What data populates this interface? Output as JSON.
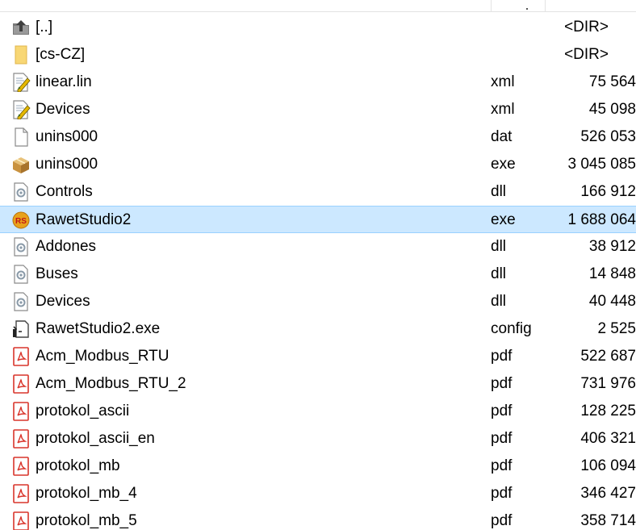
{
  "files": [
    {
      "name": "[..]",
      "ext": "",
      "size": "<DIR>",
      "icon": "up-folder-icon",
      "selected": false,
      "is_dir": true
    },
    {
      "name": "[cs-CZ]",
      "ext": "",
      "size": "<DIR>",
      "icon": "folder-icon",
      "selected": false,
      "is_dir": true
    },
    {
      "name": "linear.lin",
      "ext": "xml",
      "size": "75 564",
      "icon": "xml-file-icon",
      "selected": false,
      "is_dir": false
    },
    {
      "name": "Devices",
      "ext": "xml",
      "size": "45 098",
      "icon": "xml-file-icon",
      "selected": false,
      "is_dir": false
    },
    {
      "name": "unins000",
      "ext": "dat",
      "size": "526 053",
      "icon": "blank-file-icon",
      "selected": false,
      "is_dir": false
    },
    {
      "name": "unins000",
      "ext": "exe",
      "size": "3 045 085",
      "icon": "installer-box-icon",
      "selected": false,
      "is_dir": false
    },
    {
      "name": "Controls",
      "ext": "dll",
      "size": "166 912",
      "icon": "dll-file-icon",
      "selected": false,
      "is_dir": false
    },
    {
      "name": "RawetStudio2",
      "ext": "exe",
      "size": "1 688 064",
      "icon": "rawet-studio-icon",
      "selected": true,
      "is_dir": false
    },
    {
      "name": "Addones",
      "ext": "dll",
      "size": "38 912",
      "icon": "dll-file-icon",
      "selected": false,
      "is_dir": false
    },
    {
      "name": "Buses",
      "ext": "dll",
      "size": "14 848",
      "icon": "dll-file-icon",
      "selected": false,
      "is_dir": false
    },
    {
      "name": "Devices",
      "ext": "dll",
      "size": "40 448",
      "icon": "dll-file-icon",
      "selected": false,
      "is_dir": false
    },
    {
      "name": "RawetStudio2.exe",
      "ext": "config",
      "size": "2 525",
      "icon": "config-file-icon",
      "selected": false,
      "is_dir": false
    },
    {
      "name": "Acm_Modbus_RTU",
      "ext": "pdf",
      "size": "522 687",
      "icon": "pdf-file-icon",
      "selected": false,
      "is_dir": false
    },
    {
      "name": "Acm_Modbus_RTU_2",
      "ext": "pdf",
      "size": "731 976",
      "icon": "pdf-file-icon",
      "selected": false,
      "is_dir": false
    },
    {
      "name": "protokol_ascii",
      "ext": "pdf",
      "size": "128 225",
      "icon": "pdf-file-icon",
      "selected": false,
      "is_dir": false
    },
    {
      "name": "protokol_ascii_en",
      "ext": "pdf",
      "size": "406 321",
      "icon": "pdf-file-icon",
      "selected": false,
      "is_dir": false
    },
    {
      "name": "protokol_mb",
      "ext": "pdf",
      "size": "106 094",
      "icon": "pdf-file-icon",
      "selected": false,
      "is_dir": false
    },
    {
      "name": "protokol_mb_4",
      "ext": "pdf",
      "size": "346 427",
      "icon": "pdf-file-icon",
      "selected": false,
      "is_dir": false
    },
    {
      "name": "protokol_mb_5",
      "ext": "pdf",
      "size": "358 714",
      "icon": "pdf-file-icon",
      "selected": false,
      "is_dir": false
    }
  ],
  "colors": {
    "selection_bg": "#cce8ff",
    "selection_border": "#99d1ff",
    "pdf_red": "#d9352b",
    "folder_yellow": "#f8d775"
  }
}
